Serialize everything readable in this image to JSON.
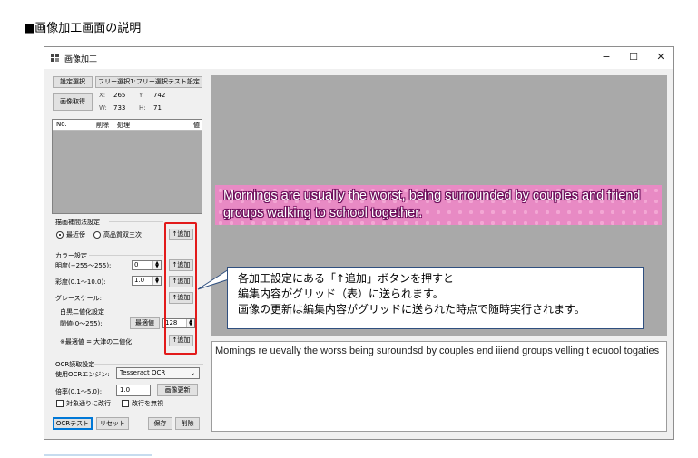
{
  "doc": {
    "heading": "■画像加工画面の説明"
  },
  "window": {
    "title": "画像加工",
    "minimize": "−",
    "maximize": "☐",
    "close": "✕"
  },
  "controls": {
    "settings_select_label": "設定選択",
    "preset_label": "フリー選択1:フリー選択テスト設定",
    "capture_label": "画像取得",
    "x_label": "X:",
    "x_value": "265",
    "y_label": "Y:",
    "y_value": "742",
    "w_label": "W:",
    "w_value": "733",
    "h_label": "H:",
    "h_value": "71"
  },
  "grid": {
    "columns": [
      "No.",
      "削除",
      "処理",
      "値"
    ]
  },
  "interpolation": {
    "group_label": "描画補間法設定",
    "option_nearest": "最近傍",
    "option_bicubic": "高品質双三次",
    "selected": "最近傍"
  },
  "color": {
    "group_label": "カラー設定",
    "brightness_label": "明度(−255〜255):",
    "brightness_value": "0",
    "saturation_label": "彩度(0.1〜10.0):",
    "saturation_value": "1.0",
    "grayscale_label": "グレースケール:",
    "binarize_group_label": "白黒二値化設定",
    "threshold_label": "閾値(0〜255):",
    "optimal_button": "最適値",
    "threshold_value": "128",
    "note": "※最適値 = 大津の二値化"
  },
  "add_button_label": "↑追加",
  "ocr": {
    "group_label": "OCR読取設定",
    "engine_label": "使用OCRエンジン:",
    "engine_value": "Tesseract OCR",
    "scale_label": "倍率(0.1〜5.0):",
    "scale_value": "1.0",
    "image_update_button": "画像更新",
    "wrap_label": "対象通りに改行",
    "ignore_newline_label": "改行を無視"
  },
  "bottom_buttons": {
    "ocr_test": "OCRテスト",
    "reset": "リセット",
    "save": "保存",
    "delete": "削除"
  },
  "image_text": "Mornings are usually the worst, being surrounded by couples and friend groups walking to school together.",
  "ocr_result": "Momings re uevally the worss being suroundsd by couples end iiiend groups velling t ecuool togaties",
  "callout": {
    "line1": "各加工設定にある「↑追加」ボタンを押すと",
    "line2": "編集内容がグリッド（表）に送られます。",
    "line3": "画像の更新は編集内容がグリッドに送られた時点で随時実行されます。"
  },
  "colors": {
    "highlight": "#e21a1a",
    "image_strip": "#e88ac4",
    "primary_button_border": "#0078d7"
  }
}
